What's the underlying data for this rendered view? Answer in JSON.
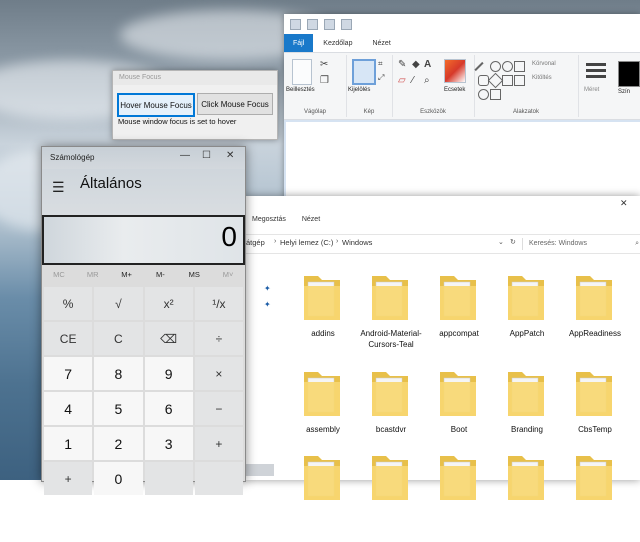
{
  "paint": {
    "menu": [
      "Fájl",
      "Kezdőlap",
      "Nézet"
    ],
    "groups": [
      "Vágólap",
      "Kép",
      "Eszközök",
      "Alakzatok"
    ],
    "tools": {
      "paste": "Beillesztés",
      "select": "Kijelölés",
      "brushes": "Ecsetek",
      "outline": "Körvonal",
      "fill": "Kitöltés",
      "size": "Méret",
      "color": "Szín"
    }
  },
  "focus_dialog": {
    "title": "Mouse Focus",
    "hover_button": "Hover Mouse Focus",
    "click_button": "Click Mouse Focus",
    "status": "Mouse window focus is set to hover"
  },
  "explorer": {
    "tabs": [
      "Megosztás",
      "Nézet"
    ],
    "breadcrumb": [
      "átgép",
      "Helyi lemez (C:)",
      "Windows"
    ],
    "search_placeholder": "Keresés: Windows",
    "folders": [
      "addins",
      "Android-Material-Cursors-Teal",
      "appcompat",
      "AppPatch",
      "AppReadiness",
      "assembly",
      "bcastdvr",
      "Boot",
      "Branding",
      "CbsTemp",
      "",
      "",
      "",
      "",
      ""
    ]
  },
  "calculator": {
    "title": "Számológép",
    "mode": "Általános",
    "display": "0",
    "memory": [
      "MC",
      "MR",
      "M+",
      "M-",
      "MS",
      "M˅"
    ],
    "keys": [
      {
        "label": "%",
        "kind": "op"
      },
      {
        "label": "√",
        "kind": "op"
      },
      {
        "label": "x²",
        "kind": "op"
      },
      {
        "label": "¹/x",
        "kind": "op"
      },
      {
        "label": "CE",
        "kind": "op"
      },
      {
        "label": "C",
        "kind": "op"
      },
      {
        "label": "⌫",
        "kind": "op"
      },
      {
        "label": "÷",
        "kind": "op"
      },
      {
        "label": "7",
        "kind": "num"
      },
      {
        "label": "8",
        "kind": "num"
      },
      {
        "label": "9",
        "kind": "num"
      },
      {
        "label": "×",
        "kind": "op"
      },
      {
        "label": "4",
        "kind": "num"
      },
      {
        "label": "5",
        "kind": "num"
      },
      {
        "label": "6",
        "kind": "num"
      },
      {
        "label": "−",
        "kind": "op"
      },
      {
        "label": "1",
        "kind": "num"
      },
      {
        "label": "2",
        "kind": "num"
      },
      {
        "label": "3",
        "kind": "num"
      },
      {
        "label": "+",
        "kind": "op"
      },
      {
        "label": "+",
        "kind": "op"
      },
      {
        "label": "0",
        "kind": "num"
      },
      {
        "label": "",
        "kind": "op"
      },
      {
        "label": "",
        "kind": "op"
      }
    ]
  }
}
